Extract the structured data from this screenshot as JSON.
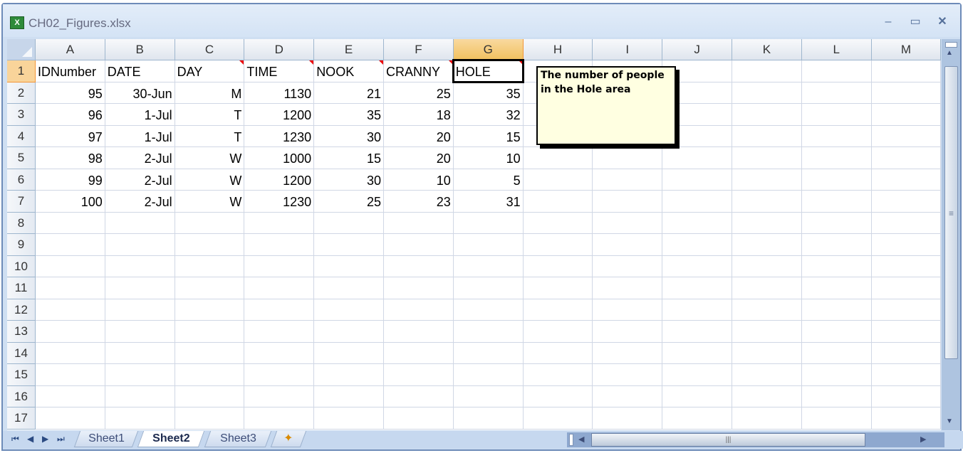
{
  "window": {
    "title": "CH02_Figures.xlsx",
    "icon": "excel-icon",
    "controls": [
      "minimize-icon",
      "restore-icon",
      "close-icon"
    ]
  },
  "columns": [
    "A",
    "B",
    "C",
    "D",
    "E",
    "F",
    "G",
    "H",
    "I",
    "J",
    "K",
    "L",
    "M"
  ],
  "rows": [
    "1",
    "2",
    "3",
    "4",
    "5",
    "6",
    "7",
    "8",
    "9",
    "10",
    "11",
    "12",
    "13",
    "14",
    "15",
    "16",
    "17"
  ],
  "selected_cell": "G1",
  "cells": [
    [
      "IDNumber",
      "DATE",
      "DAY",
      "TIME",
      "NOOK",
      "CRANNY",
      "HOLE"
    ],
    [
      "95",
      "30-Jun",
      "M",
      "1130",
      "21",
      "25",
      "35"
    ],
    [
      "96",
      "1-Jul",
      "T",
      "1200",
      "35",
      "18",
      "32"
    ],
    [
      "97",
      "1-Jul",
      "T",
      "1230",
      "30",
      "20",
      "15"
    ],
    [
      "98",
      "2-Jul",
      "W",
      "1000",
      "15",
      "20",
      "10"
    ],
    [
      "99",
      "2-Jul",
      "W",
      "1200",
      "30",
      "10",
      "5"
    ],
    [
      "100",
      "2-Jul",
      "W",
      "1230",
      "25",
      "23",
      "31"
    ]
  ],
  "comment_cells": [
    "C1",
    "D1",
    "E1",
    "F1",
    "G1"
  ],
  "comment": {
    "cell": "G1",
    "text_line1": "The number of people",
    "text_line2": "in the Hole area"
  },
  "sheets": [
    {
      "label": "Sheet1",
      "active": false
    },
    {
      "label": "Sheet2",
      "active": true
    },
    {
      "label": "Sheet3",
      "active": false
    }
  ],
  "colors": {
    "comment_bg": "#ffffe1",
    "selected_header": "#f9d49a",
    "comment_indicator": "#ee0000"
  }
}
